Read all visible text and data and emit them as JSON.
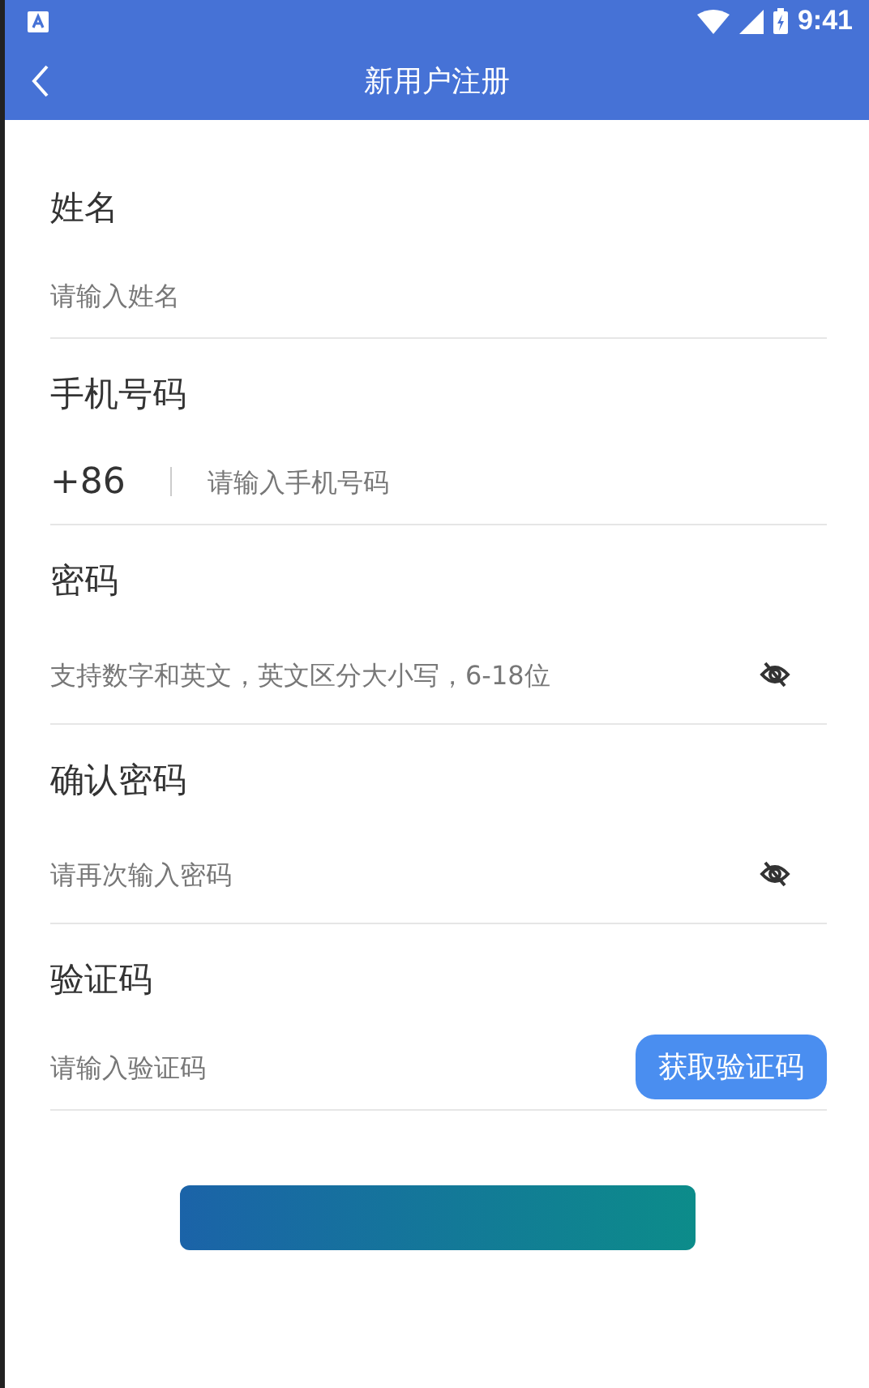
{
  "status_bar": {
    "time": "9:41"
  },
  "header": {
    "title": "新用户注册"
  },
  "fields": [
    {
      "kind": "text",
      "label": "姓名",
      "placeholder": "请输入姓名"
    },
    {
      "kind": "phone",
      "label": "手机号码",
      "prefix": "+86",
      "placeholder": "请输入手机号码"
    },
    {
      "kind": "password",
      "label": "密码",
      "placeholder": "支持数字和英文，英文区分大小写，6-18位"
    },
    {
      "kind": "password",
      "label": "确认密码",
      "placeholder": "请再次输入密码"
    },
    {
      "kind": "code",
      "label": "验证码",
      "placeholder": "请输入验证码",
      "button": "获取验证码"
    }
  ]
}
